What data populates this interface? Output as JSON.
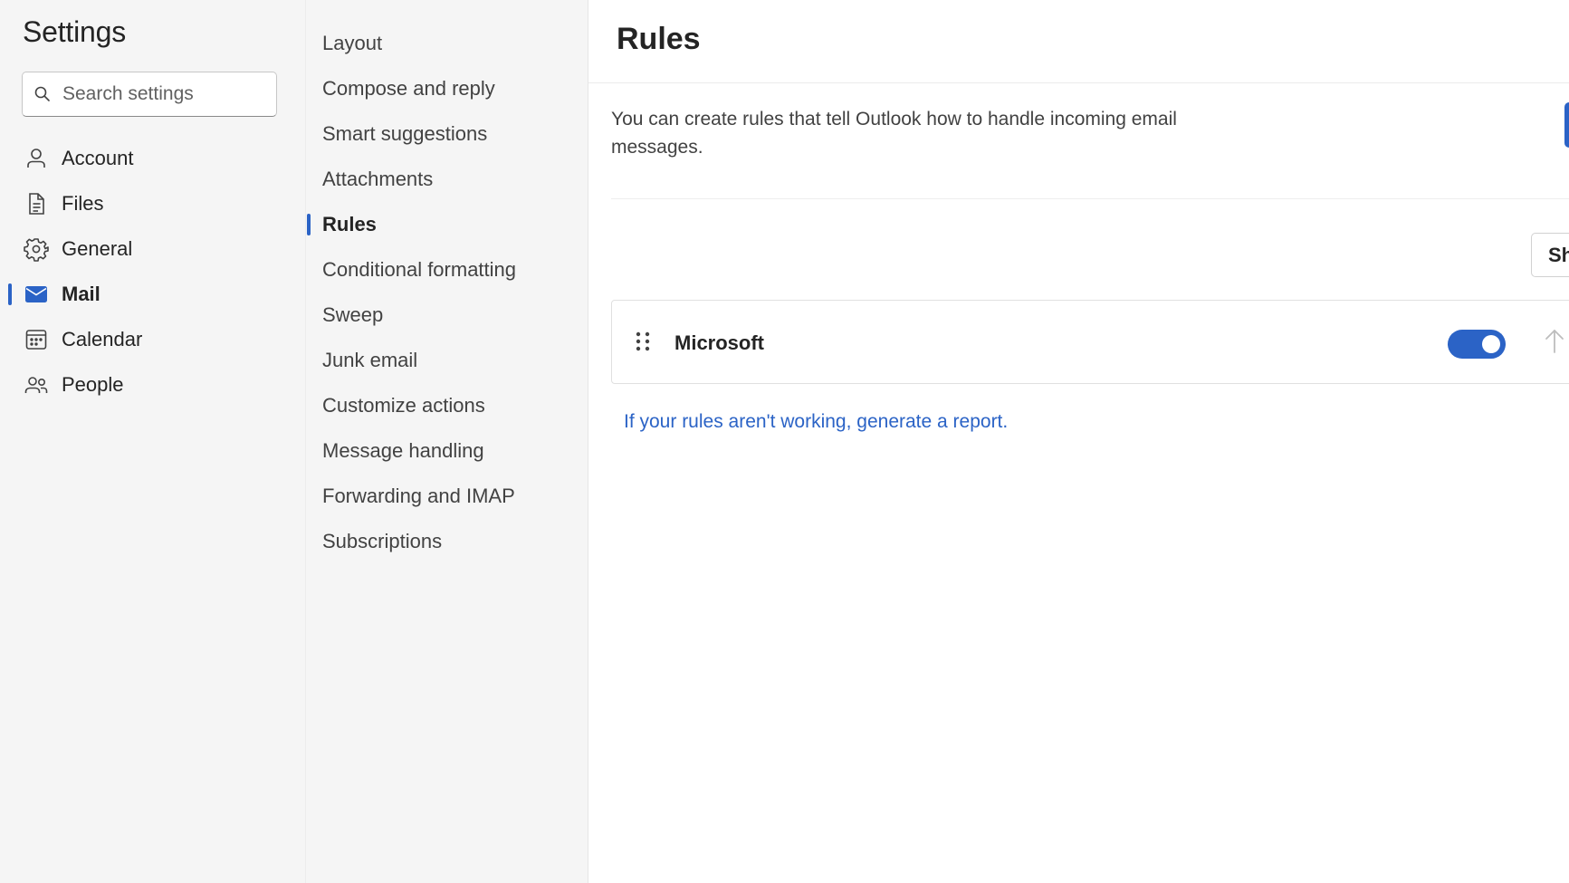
{
  "app": {
    "title": "Settings"
  },
  "search": {
    "placeholder": "Search settings",
    "icon": "search-icon"
  },
  "left_nav": {
    "items": [
      {
        "label": "Account",
        "icon": "person-icon",
        "active": false
      },
      {
        "label": "Files",
        "icon": "document-icon",
        "active": false
      },
      {
        "label": "General",
        "icon": "gear-icon",
        "active": false
      },
      {
        "label": "Mail",
        "icon": "mail-icon",
        "active": true
      },
      {
        "label": "Calendar",
        "icon": "calendar-icon",
        "active": false
      },
      {
        "label": "People",
        "icon": "people-icon",
        "active": false
      }
    ]
  },
  "mail_nav": {
    "items": [
      {
        "label": "Layout",
        "active": false
      },
      {
        "label": "Compose and reply",
        "active": false
      },
      {
        "label": "Smart suggestions",
        "active": false
      },
      {
        "label": "Attachments",
        "active": false
      },
      {
        "label": "Rules",
        "active": true
      },
      {
        "label": "Conditional formatting",
        "active": false
      },
      {
        "label": "Sweep",
        "active": false
      },
      {
        "label": "Junk email",
        "active": false
      },
      {
        "label": "Customize actions",
        "active": false
      },
      {
        "label": "Message handling",
        "active": false
      },
      {
        "label": "Forwarding and IMAP",
        "active": false
      },
      {
        "label": "Subscriptions",
        "active": false
      }
    ]
  },
  "rules_page": {
    "title": "Rules",
    "description": "You can create rules that tell Outlook how to handle incoming email messages.",
    "show_button_label": "Sh",
    "rules": [
      {
        "name": "Microsoft",
        "enabled": true
      }
    ],
    "report_link": "If your rules aren't working, generate a report."
  },
  "colors": {
    "accent": "#2b63c6",
    "pane_background": "#f5f5f5",
    "text": "#242424"
  }
}
